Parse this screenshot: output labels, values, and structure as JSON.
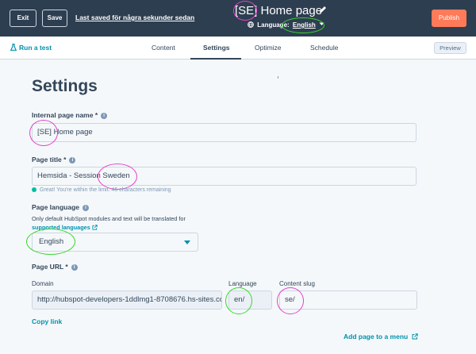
{
  "topbar": {
    "exit_label": "Exit",
    "save_label": "Save",
    "last_saved": "Last saved för några sekunder sedan",
    "page_title": "[SE] Home page",
    "language_label": "Language:",
    "language_value": "English",
    "publish_label": "Publish"
  },
  "tabbar": {
    "run_test": "Run a test",
    "tabs": [
      "Content",
      "Settings",
      "Optimize",
      "Schedule"
    ],
    "active_tab": "Settings",
    "preview_label": "Preview"
  },
  "settings": {
    "heading": "Settings",
    "internal_name_label": "Internal page name *",
    "internal_name_value": "[SE] Home page",
    "page_title_label": "Page title *",
    "page_title_value": "Hemsida - Session Sweden",
    "page_title_hint": "Great! You're within the limit. 46 characters remaining",
    "page_language_label": "Page language",
    "page_language_desc": "Only default HubSpot modules and text will be translated for",
    "page_language_link": "supported languages",
    "page_language_value": "English",
    "page_url_label": "Page URL *",
    "domain_label": "Domain",
    "domain_value": "http://hubspot-developers-1ddlmg1-8708676.hs-sites.com",
    "language_col_label": "Language",
    "language_col_value": "en/",
    "slug_label": "Content slug",
    "slug_value": "se/",
    "copy_link": "Copy link",
    "add_menu": "Add page to a menu"
  },
  "colors": {
    "topbar": "#2d3e50",
    "publish": "#ff7a59",
    "link": "#0091ae",
    "annotation_magenta": "#e245c8",
    "annotation_green": "#3bd62f"
  },
  "icons": [
    "pencil-icon",
    "globe-icon",
    "chevron-down-icon",
    "flask-icon",
    "info-icon",
    "external-link-icon",
    "check-dot-icon",
    "caret-down-icon"
  ]
}
